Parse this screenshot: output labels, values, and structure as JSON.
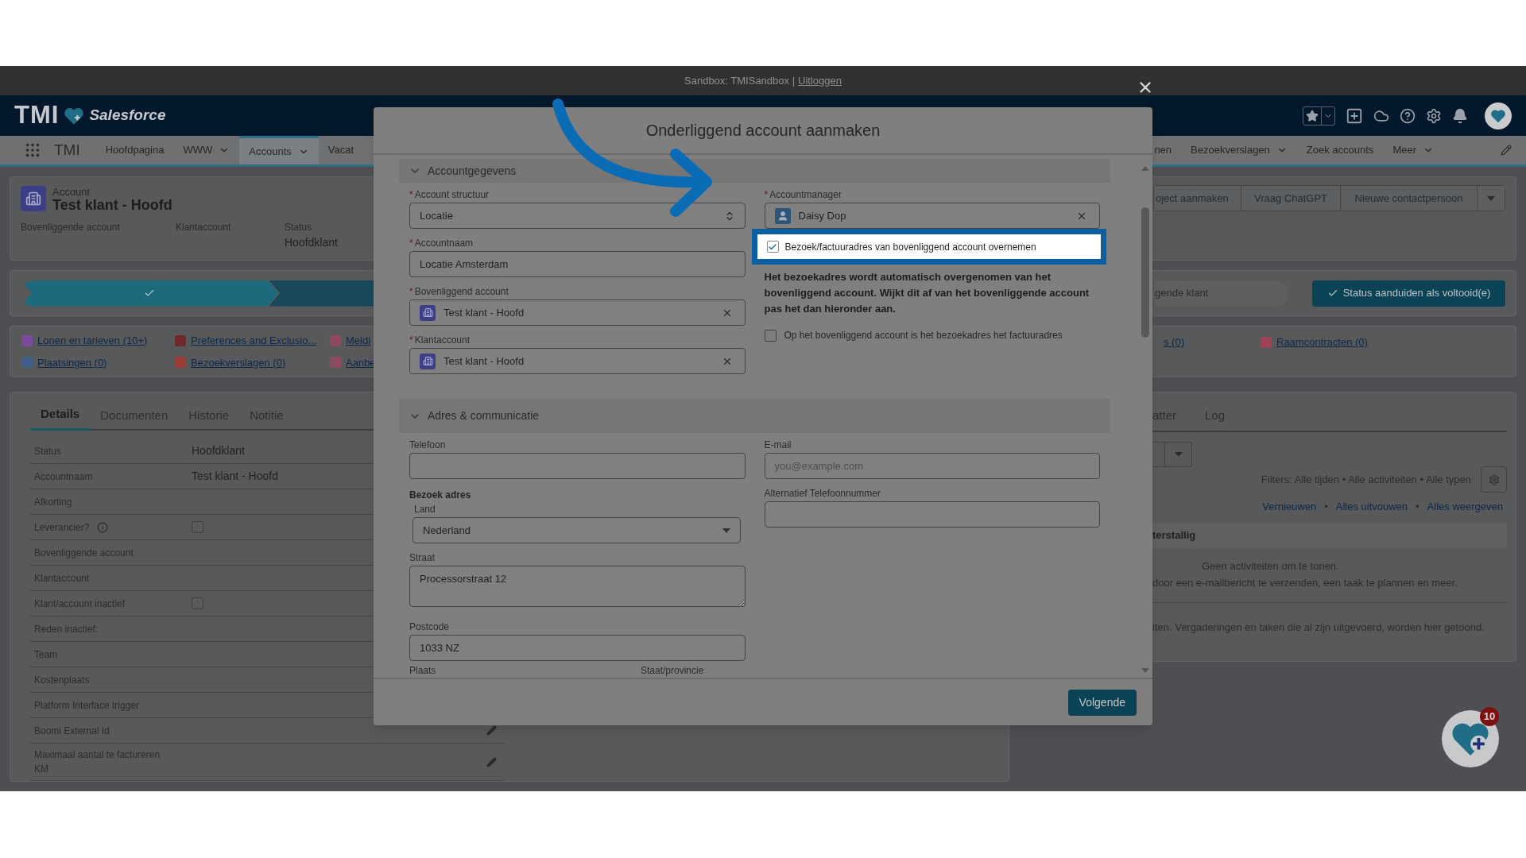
{
  "sandbox_bar": {
    "text": "Sandbox: TMISandbox |",
    "link": "Uitloggen"
  },
  "header": {
    "logo_text": "TMI",
    "logo_brand": "Salesforce"
  },
  "nav": {
    "app_name": "TMI",
    "items": [
      {
        "label": "Hoofdpagina",
        "selected": false,
        "dropdown": false
      },
      {
        "label": "WWW",
        "selected": false,
        "dropdown": true
      },
      {
        "label": "Accounts",
        "selected": true,
        "dropdown": true
      },
      {
        "label": "Vacat",
        "selected": false,
        "dropdown": false
      }
    ],
    "right_items": [
      {
        "label": "nen",
        "dropdown": false
      },
      {
        "label": "Bezoekverslagen",
        "dropdown": true
      },
      {
        "label": "Zoek accounts",
        "dropdown": false
      },
      {
        "label": "Meer",
        "dropdown": true
      }
    ]
  },
  "record": {
    "object": "Account",
    "title": "Test klant - Hoofd",
    "fields": [
      {
        "label": "Bovenliggende account"
      },
      {
        "label": "Klantaccount"
      },
      {
        "label": "Status",
        "value": "Hoofdklant"
      }
    ],
    "actions": [
      "oject aanmaken",
      "Vraag ChatGPT",
      "Nieuwe contactpersoon"
    ]
  },
  "path": {
    "stages": [
      {
        "complete": true
      },
      {
        "complete": false
      }
    ],
    "current_label": "gende klant",
    "button": "Status aanduiden als voltooid(e)"
  },
  "related_links": {
    "left": [
      {
        "label": "Lonen en tarieven (10+)",
        "color": "#7b4a9a"
      },
      {
        "label": "Preferences and Exclusio...",
        "color": "#6e2a2a"
      },
      {
        "label": "Meldi",
        "color": "#8e4a62"
      },
      {
        "label": "Plaatsingen (0)",
        "color": "#3e5f8c"
      },
      {
        "label": "Bezoekverslagen (0)",
        "color": "#9a3f36"
      },
      {
        "label": "Aanbe",
        "color": "#8e4a62"
      }
    ],
    "right": [
      {
        "label": "s (0)"
      },
      {
        "label": "Raamcontracten (0)",
        "color": "#9c4456"
      }
    ]
  },
  "details": {
    "tabs": [
      {
        "label": "Details",
        "selected": true
      },
      {
        "label": "Documenten",
        "selected": false
      },
      {
        "label": "Historie",
        "selected": false
      },
      {
        "label": "Notitie",
        "selected": false
      }
    ],
    "rows": [
      {
        "kind": "text",
        "label": "Status",
        "value": "Hoofdklant",
        "editable": false
      },
      {
        "kind": "text",
        "label": "Accountnaam",
        "value": "Test klant - Hoofd",
        "editable": false
      },
      {
        "kind": "text",
        "label": "Afkorting",
        "editable": false
      },
      {
        "kind": "checkbox",
        "label": "Leverancier?",
        "info": true,
        "checked": false,
        "editable": false
      },
      {
        "kind": "text",
        "label": "Bovenliggende account",
        "editable": false
      },
      {
        "kind": "text",
        "label": "Klantaccount",
        "editable": false
      },
      {
        "kind": "checkbox",
        "label": "Klant/account inactief",
        "checked": false,
        "editable": false
      },
      {
        "kind": "text",
        "label": "Reden inactief:",
        "editable": false
      },
      {
        "kind": "text",
        "label": "Team",
        "editable": false
      },
      {
        "kind": "text",
        "label": "Kostenplaats",
        "editable": false
      },
      {
        "kind": "text",
        "label": "Platform Interface trigger",
        "editable": false
      },
      {
        "kind": "text",
        "label": "Boomi External Id",
        "editable": true
      },
      {
        "kind": "text",
        "label": "Maximaal aantal te factureren KM",
        "editable": true
      }
    ]
  },
  "activity": {
    "tabs": [
      {
        "label": "atter",
        "selected": false
      },
      {
        "label": "Log",
        "selected": false
      }
    ],
    "filters": "Filters: Alle tijden • Alle activiteiten • Alle typen",
    "links": [
      "Vernieuwen",
      "Alles uitvouwen",
      "Alles weergeven"
    ],
    "link_separator": "•",
    "section": "terstallig",
    "empty_lines": [
      "Geen activiteiten om te tonen.",
      "door een e-mailbericht te verzenden, een taak te plannen en meer."
    ],
    "past_note": "iten. Vergaderingen en taken die al zijn uitgevoerd, worden hier getoond."
  },
  "modal": {
    "title": "Onderliggend account aanmaken",
    "account_section": {
      "title": "Accountgegevens",
      "expanded": true,
      "left_fields": [
        {
          "kind": "select",
          "marker": "*",
          "label": "Account structuur",
          "value": "Locatie"
        },
        {
          "kind": "text",
          "marker": "*",
          "label": "Accountnaam",
          "value": "Locatie Amsterdam"
        },
        {
          "kind": "lookup",
          "marker": "*",
          "label": "Bovenliggend account",
          "value": "Test klant - Hoofd"
        },
        {
          "kind": "lookup",
          "marker": "*",
          "label": "Klantaccount",
          "value": "Test klant - Hoofd"
        }
      ],
      "right_fields": [
        {
          "kind": "lookup",
          "marker": "*",
          "label": "Accountmanager",
          "value": "Daisy Dop"
        }
      ],
      "copy_address": {
        "label": "Bezoek/factuuradres van bovenliggend account overnemen",
        "checked": true,
        "highlighted": true
      },
      "note": "Het bezoekadres wordt automatisch overgenomen van het bovenliggend account. Wijkt dit af van het bovenliggende account pas het dan hieronder aan.",
      "same_billing": {
        "label": "Op het bovenliggend account is het bezoekadres het factuuradres",
        "checked": false
      }
    },
    "address_section": {
      "title": "Adres & communicatie",
      "expanded": true,
      "left_fields": [
        {
          "kind": "text",
          "label": "Telefoon"
        },
        {
          "kind": "heading",
          "label": "Bezoek adres"
        },
        {
          "kind": "picklist",
          "label": "Land",
          "value": "Nederland"
        },
        {
          "kind": "textarea",
          "label": "Straat",
          "value": "Processorstraat 12"
        },
        {
          "kind": "text",
          "label": "Postcode",
          "value": "1033 NZ"
        }
      ],
      "cut_labels": [
        "Plaats",
        "Staat/provincie"
      ],
      "right_fields": [
        {
          "kind": "text",
          "label": "E-mail",
          "placeholder": "you@example.com"
        },
        {
          "kind": "text",
          "label": "Alternatief Telefoonnummer"
        }
      ]
    },
    "next_button": "Volgende"
  },
  "fab": {
    "badge": "10"
  }
}
